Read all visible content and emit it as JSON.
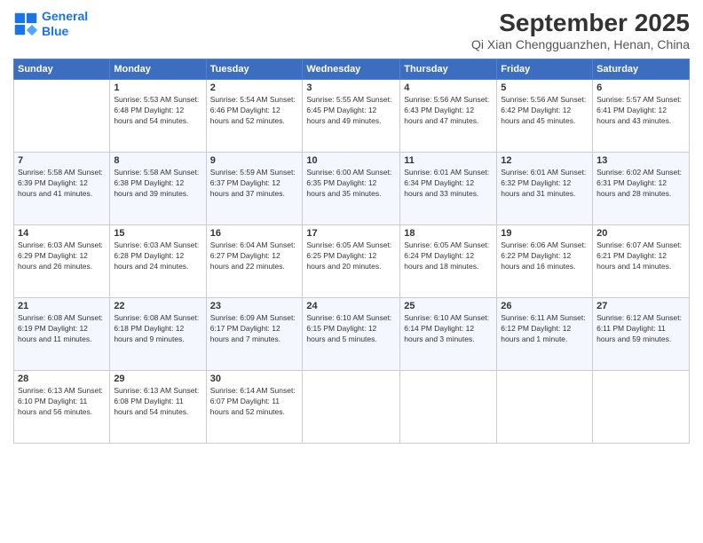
{
  "logo": {
    "line1": "General",
    "line2": "Blue"
  },
  "title": "September 2025",
  "location": "Qi Xian Chengguanzhen, Henan, China",
  "weekdays": [
    "Sunday",
    "Monday",
    "Tuesday",
    "Wednesday",
    "Thursday",
    "Friday",
    "Saturday"
  ],
  "weeks": [
    [
      {
        "day": "",
        "info": ""
      },
      {
        "day": "1",
        "info": "Sunrise: 5:53 AM\nSunset: 6:48 PM\nDaylight: 12 hours\nand 54 minutes."
      },
      {
        "day": "2",
        "info": "Sunrise: 5:54 AM\nSunset: 6:46 PM\nDaylight: 12 hours\nand 52 minutes."
      },
      {
        "day": "3",
        "info": "Sunrise: 5:55 AM\nSunset: 6:45 PM\nDaylight: 12 hours\nand 49 minutes."
      },
      {
        "day": "4",
        "info": "Sunrise: 5:56 AM\nSunset: 6:43 PM\nDaylight: 12 hours\nand 47 minutes."
      },
      {
        "day": "5",
        "info": "Sunrise: 5:56 AM\nSunset: 6:42 PM\nDaylight: 12 hours\nand 45 minutes."
      },
      {
        "day": "6",
        "info": "Sunrise: 5:57 AM\nSunset: 6:41 PM\nDaylight: 12 hours\nand 43 minutes."
      }
    ],
    [
      {
        "day": "7",
        "info": "Sunrise: 5:58 AM\nSunset: 6:39 PM\nDaylight: 12 hours\nand 41 minutes."
      },
      {
        "day": "8",
        "info": "Sunrise: 5:58 AM\nSunset: 6:38 PM\nDaylight: 12 hours\nand 39 minutes."
      },
      {
        "day": "9",
        "info": "Sunrise: 5:59 AM\nSunset: 6:37 PM\nDaylight: 12 hours\nand 37 minutes."
      },
      {
        "day": "10",
        "info": "Sunrise: 6:00 AM\nSunset: 6:35 PM\nDaylight: 12 hours\nand 35 minutes."
      },
      {
        "day": "11",
        "info": "Sunrise: 6:01 AM\nSunset: 6:34 PM\nDaylight: 12 hours\nand 33 minutes."
      },
      {
        "day": "12",
        "info": "Sunrise: 6:01 AM\nSunset: 6:32 PM\nDaylight: 12 hours\nand 31 minutes."
      },
      {
        "day": "13",
        "info": "Sunrise: 6:02 AM\nSunset: 6:31 PM\nDaylight: 12 hours\nand 28 minutes."
      }
    ],
    [
      {
        "day": "14",
        "info": "Sunrise: 6:03 AM\nSunset: 6:29 PM\nDaylight: 12 hours\nand 26 minutes."
      },
      {
        "day": "15",
        "info": "Sunrise: 6:03 AM\nSunset: 6:28 PM\nDaylight: 12 hours\nand 24 minutes."
      },
      {
        "day": "16",
        "info": "Sunrise: 6:04 AM\nSunset: 6:27 PM\nDaylight: 12 hours\nand 22 minutes."
      },
      {
        "day": "17",
        "info": "Sunrise: 6:05 AM\nSunset: 6:25 PM\nDaylight: 12 hours\nand 20 minutes."
      },
      {
        "day": "18",
        "info": "Sunrise: 6:05 AM\nSunset: 6:24 PM\nDaylight: 12 hours\nand 18 minutes."
      },
      {
        "day": "19",
        "info": "Sunrise: 6:06 AM\nSunset: 6:22 PM\nDaylight: 12 hours\nand 16 minutes."
      },
      {
        "day": "20",
        "info": "Sunrise: 6:07 AM\nSunset: 6:21 PM\nDaylight: 12 hours\nand 14 minutes."
      }
    ],
    [
      {
        "day": "21",
        "info": "Sunrise: 6:08 AM\nSunset: 6:19 PM\nDaylight: 12 hours\nand 11 minutes."
      },
      {
        "day": "22",
        "info": "Sunrise: 6:08 AM\nSunset: 6:18 PM\nDaylight: 12 hours\nand 9 minutes."
      },
      {
        "day": "23",
        "info": "Sunrise: 6:09 AM\nSunset: 6:17 PM\nDaylight: 12 hours\nand 7 minutes."
      },
      {
        "day": "24",
        "info": "Sunrise: 6:10 AM\nSunset: 6:15 PM\nDaylight: 12 hours\nand 5 minutes."
      },
      {
        "day": "25",
        "info": "Sunrise: 6:10 AM\nSunset: 6:14 PM\nDaylight: 12 hours\nand 3 minutes."
      },
      {
        "day": "26",
        "info": "Sunrise: 6:11 AM\nSunset: 6:12 PM\nDaylight: 12 hours\nand 1 minute."
      },
      {
        "day": "27",
        "info": "Sunrise: 6:12 AM\nSunset: 6:11 PM\nDaylight: 11 hours\nand 59 minutes."
      }
    ],
    [
      {
        "day": "28",
        "info": "Sunrise: 6:13 AM\nSunset: 6:10 PM\nDaylight: 11 hours\nand 56 minutes."
      },
      {
        "day": "29",
        "info": "Sunrise: 6:13 AM\nSunset: 6:08 PM\nDaylight: 11 hours\nand 54 minutes."
      },
      {
        "day": "30",
        "info": "Sunrise: 6:14 AM\nSunset: 6:07 PM\nDaylight: 11 hours\nand 52 minutes."
      },
      {
        "day": "",
        "info": ""
      },
      {
        "day": "",
        "info": ""
      },
      {
        "day": "",
        "info": ""
      },
      {
        "day": "",
        "info": ""
      }
    ]
  ]
}
